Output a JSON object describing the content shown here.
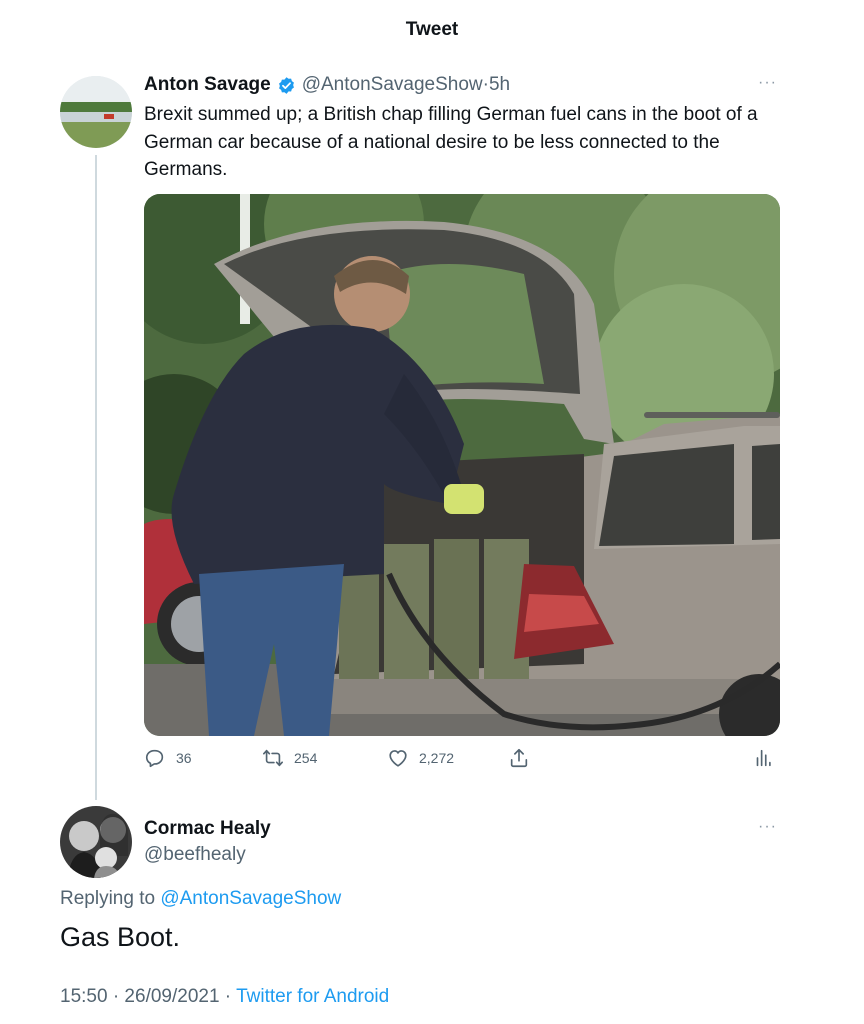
{
  "header": {
    "title": "Tweet"
  },
  "tweet": {
    "author_name": "Anton Savage",
    "author_handle": "@AntonSavageShow",
    "separator": " · ",
    "age": "5h",
    "more": "···",
    "text": "Brexit summed up; a British chap filling German fuel cans in the boot of a German car because of a national desire to be less connected to the Germans.",
    "stats": {
      "replies": "36",
      "retweets": "254",
      "likes": "2,272"
    },
    "icons": [
      "verified-badge-icon",
      "reply-icon",
      "retweet-icon",
      "like-icon",
      "share-icon",
      "analytics-icon"
    ],
    "accent_color": "#1d9bf0"
  },
  "reply": {
    "author_name": "Cormac Healy",
    "author_handle": "@beefhealy",
    "more": "···",
    "replying_prefix": "Replying to ",
    "replying_to": "@AntonSavageShow",
    "text": "Gas Boot.",
    "time": "15:50 · 26/09/2021",
    "separator": " · ",
    "source": "Twitter for Android"
  }
}
